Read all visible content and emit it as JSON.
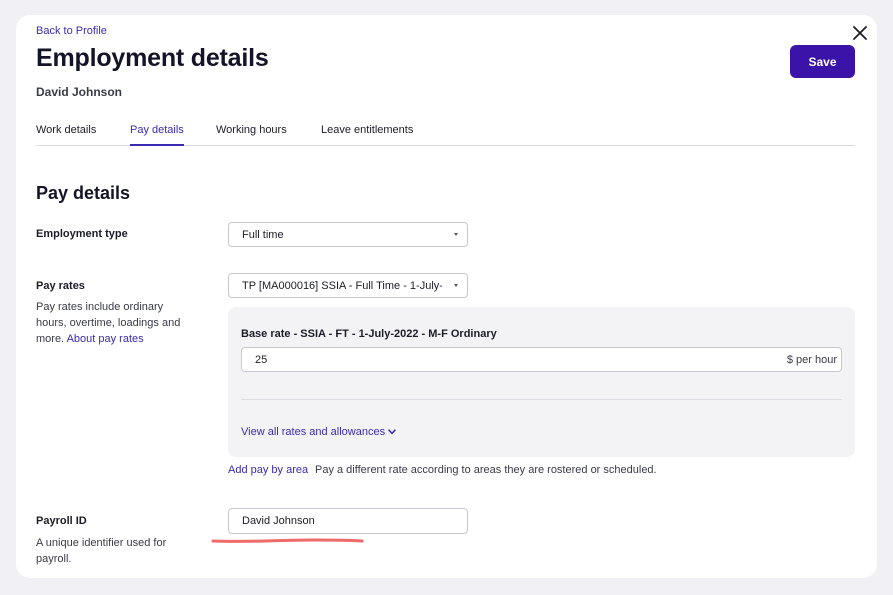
{
  "header": {
    "back_link": "Back to Profile",
    "title": "Employment details",
    "employee_name": "David Johnson",
    "save_label": "Save"
  },
  "tabs": [
    {
      "label": "Work details",
      "active": false
    },
    {
      "label": "Pay details",
      "active": true
    },
    {
      "label": "Working hours",
      "active": false
    },
    {
      "label": "Leave entitlements",
      "active": false
    }
  ],
  "section": {
    "title": "Pay details"
  },
  "employment_type": {
    "label": "Employment type",
    "value": "Full time"
  },
  "pay_rates": {
    "label": "Pay rates",
    "help_text": "Pay rates include ordinary hours, overtime, loadings and more.",
    "help_link": "About pay rates",
    "selected": "TP [MA000016] SSIA - Full Time - 1-July-",
    "base_rate_title": "Base rate - SSIA - FT - 1-July-2022 - M-F Ordinary",
    "base_rate_value": "25",
    "base_rate_unit": "$ per hour",
    "view_all_label": "View all rates and allowances",
    "add_pay_label": "Add pay by area",
    "add_pay_desc": "Pay a different rate according to areas they are rostered or scheduled."
  },
  "payroll_id": {
    "label": "Payroll ID",
    "help_text": "A unique identifier used for payroll.",
    "value": "David Johnson"
  },
  "colors": {
    "accent": "#3b13a8",
    "link": "#3b2bb0",
    "annotation": "#f06a6a"
  },
  "icons": [
    "close-icon",
    "chevron-down-icon"
  ]
}
